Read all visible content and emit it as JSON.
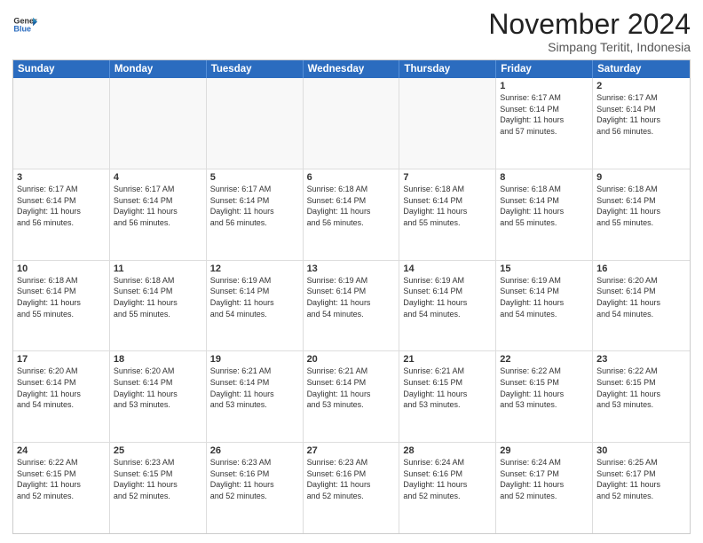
{
  "header": {
    "logo_line1": "General",
    "logo_line2": "Blue",
    "month_title": "November 2024",
    "location": "Simpang Teritit, Indonesia"
  },
  "weekdays": [
    "Sunday",
    "Monday",
    "Tuesday",
    "Wednesday",
    "Thursday",
    "Friday",
    "Saturday"
  ],
  "rows": [
    [
      {
        "day": "",
        "info": "",
        "empty": true
      },
      {
        "day": "",
        "info": "",
        "empty": true
      },
      {
        "day": "",
        "info": "",
        "empty": true
      },
      {
        "day": "",
        "info": "",
        "empty": true
      },
      {
        "day": "",
        "info": "",
        "empty": true
      },
      {
        "day": "1",
        "info": "Sunrise: 6:17 AM\nSunset: 6:14 PM\nDaylight: 11 hours\nand 57 minutes.",
        "empty": false
      },
      {
        "day": "2",
        "info": "Sunrise: 6:17 AM\nSunset: 6:14 PM\nDaylight: 11 hours\nand 56 minutes.",
        "empty": false
      }
    ],
    [
      {
        "day": "3",
        "info": "Sunrise: 6:17 AM\nSunset: 6:14 PM\nDaylight: 11 hours\nand 56 minutes.",
        "empty": false
      },
      {
        "day": "4",
        "info": "Sunrise: 6:17 AM\nSunset: 6:14 PM\nDaylight: 11 hours\nand 56 minutes.",
        "empty": false
      },
      {
        "day": "5",
        "info": "Sunrise: 6:17 AM\nSunset: 6:14 PM\nDaylight: 11 hours\nand 56 minutes.",
        "empty": false
      },
      {
        "day": "6",
        "info": "Sunrise: 6:18 AM\nSunset: 6:14 PM\nDaylight: 11 hours\nand 56 minutes.",
        "empty": false
      },
      {
        "day": "7",
        "info": "Sunrise: 6:18 AM\nSunset: 6:14 PM\nDaylight: 11 hours\nand 55 minutes.",
        "empty": false
      },
      {
        "day": "8",
        "info": "Sunrise: 6:18 AM\nSunset: 6:14 PM\nDaylight: 11 hours\nand 55 minutes.",
        "empty": false
      },
      {
        "day": "9",
        "info": "Sunrise: 6:18 AM\nSunset: 6:14 PM\nDaylight: 11 hours\nand 55 minutes.",
        "empty": false
      }
    ],
    [
      {
        "day": "10",
        "info": "Sunrise: 6:18 AM\nSunset: 6:14 PM\nDaylight: 11 hours\nand 55 minutes.",
        "empty": false
      },
      {
        "day": "11",
        "info": "Sunrise: 6:18 AM\nSunset: 6:14 PM\nDaylight: 11 hours\nand 55 minutes.",
        "empty": false
      },
      {
        "day": "12",
        "info": "Sunrise: 6:19 AM\nSunset: 6:14 PM\nDaylight: 11 hours\nand 54 minutes.",
        "empty": false
      },
      {
        "day": "13",
        "info": "Sunrise: 6:19 AM\nSunset: 6:14 PM\nDaylight: 11 hours\nand 54 minutes.",
        "empty": false
      },
      {
        "day": "14",
        "info": "Sunrise: 6:19 AM\nSunset: 6:14 PM\nDaylight: 11 hours\nand 54 minutes.",
        "empty": false
      },
      {
        "day": "15",
        "info": "Sunrise: 6:19 AM\nSunset: 6:14 PM\nDaylight: 11 hours\nand 54 minutes.",
        "empty": false
      },
      {
        "day": "16",
        "info": "Sunrise: 6:20 AM\nSunset: 6:14 PM\nDaylight: 11 hours\nand 54 minutes.",
        "empty": false
      }
    ],
    [
      {
        "day": "17",
        "info": "Sunrise: 6:20 AM\nSunset: 6:14 PM\nDaylight: 11 hours\nand 54 minutes.",
        "empty": false
      },
      {
        "day": "18",
        "info": "Sunrise: 6:20 AM\nSunset: 6:14 PM\nDaylight: 11 hours\nand 53 minutes.",
        "empty": false
      },
      {
        "day": "19",
        "info": "Sunrise: 6:21 AM\nSunset: 6:14 PM\nDaylight: 11 hours\nand 53 minutes.",
        "empty": false
      },
      {
        "day": "20",
        "info": "Sunrise: 6:21 AM\nSunset: 6:14 PM\nDaylight: 11 hours\nand 53 minutes.",
        "empty": false
      },
      {
        "day": "21",
        "info": "Sunrise: 6:21 AM\nSunset: 6:15 PM\nDaylight: 11 hours\nand 53 minutes.",
        "empty": false
      },
      {
        "day": "22",
        "info": "Sunrise: 6:22 AM\nSunset: 6:15 PM\nDaylight: 11 hours\nand 53 minutes.",
        "empty": false
      },
      {
        "day": "23",
        "info": "Sunrise: 6:22 AM\nSunset: 6:15 PM\nDaylight: 11 hours\nand 53 minutes.",
        "empty": false
      }
    ],
    [
      {
        "day": "24",
        "info": "Sunrise: 6:22 AM\nSunset: 6:15 PM\nDaylight: 11 hours\nand 52 minutes.",
        "empty": false
      },
      {
        "day": "25",
        "info": "Sunrise: 6:23 AM\nSunset: 6:15 PM\nDaylight: 11 hours\nand 52 minutes.",
        "empty": false
      },
      {
        "day": "26",
        "info": "Sunrise: 6:23 AM\nSunset: 6:16 PM\nDaylight: 11 hours\nand 52 minutes.",
        "empty": false
      },
      {
        "day": "27",
        "info": "Sunrise: 6:23 AM\nSunset: 6:16 PM\nDaylight: 11 hours\nand 52 minutes.",
        "empty": false
      },
      {
        "day": "28",
        "info": "Sunrise: 6:24 AM\nSunset: 6:16 PM\nDaylight: 11 hours\nand 52 minutes.",
        "empty": false
      },
      {
        "day": "29",
        "info": "Sunrise: 6:24 AM\nSunset: 6:17 PM\nDaylight: 11 hours\nand 52 minutes.",
        "empty": false
      },
      {
        "day": "30",
        "info": "Sunrise: 6:25 AM\nSunset: 6:17 PM\nDaylight: 11 hours\nand 52 minutes.",
        "empty": false
      }
    ]
  ]
}
